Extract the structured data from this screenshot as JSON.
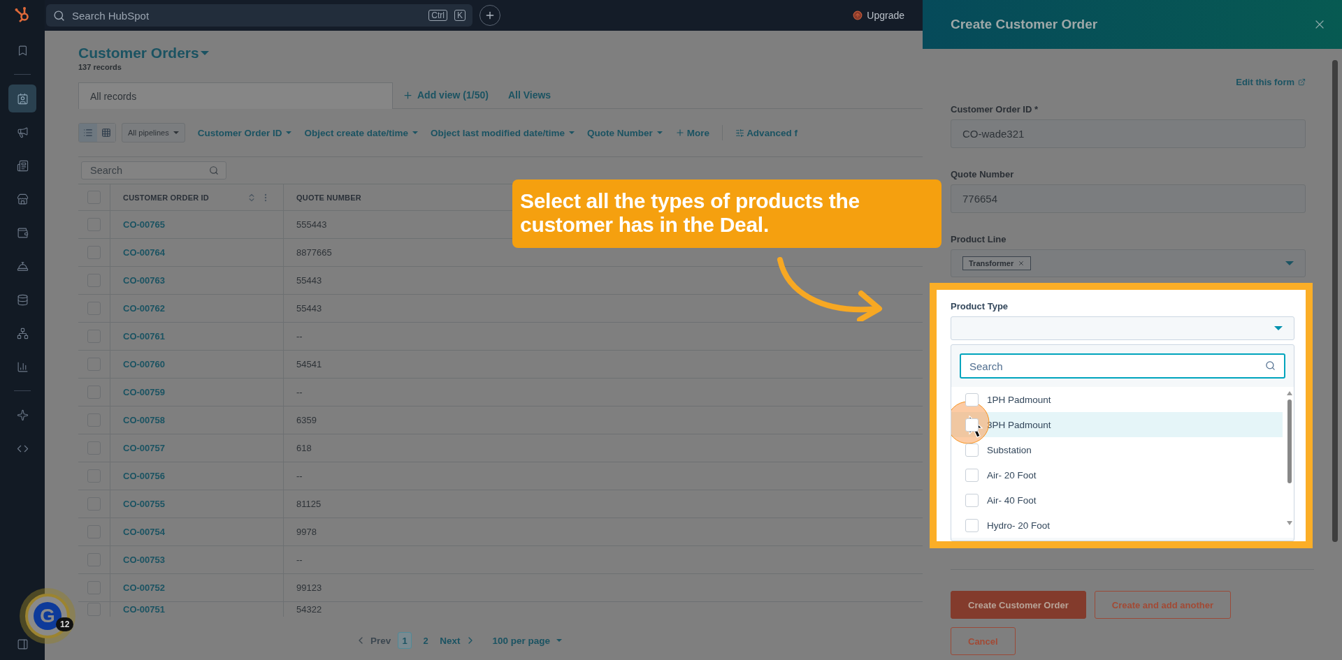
{
  "top_bar": {
    "search_placeholder": "Search HubSpot",
    "shortcut_keys": [
      "Ctrl",
      "K"
    ],
    "upgrade": "Upgrade"
  },
  "sidebar": {
    "items": [
      {
        "selected": false
      },
      {
        "selected": true
      },
      {
        "selected": false
      },
      {
        "selected": false
      },
      {
        "selected": false
      },
      {
        "selected": false
      },
      {
        "selected": false
      },
      {
        "selected": false
      },
      {
        "selected": false
      },
      {
        "selected": false
      },
      {
        "selected": false
      },
      {
        "selected": false
      }
    ]
  },
  "view": {
    "title": "Customer Orders",
    "record_count": "137 records"
  },
  "view_tabs": [
    {
      "label": "All records",
      "selected": true
    }
  ],
  "add_view": "Add view (1/50)",
  "all_views": "All Views",
  "filters": {
    "view_modes": [
      {
        "selected": true
      },
      {
        "selected": false
      }
    ],
    "pipeline": "All pipelines",
    "items": [
      "Customer Order ID",
      "Object create date/time",
      "Object last modified date/time",
      "Quote Number"
    ],
    "more": "More",
    "advanced": "Advanced f"
  },
  "table": {
    "search_placeholder": "Search",
    "all_checked": false,
    "columns": [
      "CUSTOMER ORDER ID",
      "QUOTE NUMBER"
    ],
    "rows": [
      {
        "id": "CO-00765",
        "quote": "555443",
        "checked": false
      },
      {
        "id": "CO-00764",
        "quote": "8877665",
        "checked": false
      },
      {
        "id": "CO-00763",
        "quote": "55443",
        "checked": false
      },
      {
        "id": "CO-00762",
        "quote": "55443",
        "checked": false
      },
      {
        "id": "CO-00761",
        "quote": "--",
        "checked": false
      },
      {
        "id": "CO-00760",
        "quote": "54541",
        "checked": false
      },
      {
        "id": "CO-00759",
        "quote": "--",
        "checked": false
      },
      {
        "id": "CO-00758",
        "quote": "6359",
        "checked": false
      },
      {
        "id": "CO-00757",
        "quote": "618",
        "checked": false
      },
      {
        "id": "CO-00756",
        "quote": "--",
        "checked": false
      },
      {
        "id": "CO-00755",
        "quote": "81125",
        "checked": false
      },
      {
        "id": "CO-00754",
        "quote": "9978",
        "checked": false
      },
      {
        "id": "CO-00753",
        "quote": "--",
        "checked": false
      },
      {
        "id": "CO-00752",
        "quote": "99123",
        "checked": false
      },
      {
        "id": "CO-00751",
        "quote": "54322",
        "checked": false
      }
    ]
  },
  "pagination": {
    "prev": "Prev",
    "pages": [
      {
        "label": "1",
        "selected": true
      },
      {
        "label": "2",
        "selected": false
      }
    ],
    "next": "Next",
    "per_page": "100 per page"
  },
  "callout": {
    "text": "Select all the types of products the customer has in the Deal."
  },
  "panel": {
    "title": "Create Customer Order",
    "edit_link": "Edit this form",
    "fields": [
      {
        "label": "Customer Order ID *",
        "value": "CO-wade321"
      },
      {
        "label": "Quote Number",
        "value": "776654"
      }
    ],
    "product_line": {
      "label": "Product Line",
      "tags": [
        "Transformer"
      ]
    },
    "product_type": {
      "label": "Product Type",
      "expanded": true,
      "search_placeholder": "Search",
      "options": [
        {
          "label": "1PH Padmount",
          "checked": false,
          "highlighted": false
        },
        {
          "label": "3PH Padmount",
          "checked": false,
          "highlighted": true
        },
        {
          "label": "Substation",
          "checked": false,
          "highlighted": false
        },
        {
          "label": "Air- 20 Foot",
          "checked": false,
          "highlighted": false
        },
        {
          "label": "Air- 40 Foot",
          "checked": false,
          "highlighted": false
        },
        {
          "label": "Hydro- 20 Foot",
          "checked": false,
          "highlighted": false
        }
      ]
    },
    "buttons": [
      {
        "label": "Create Customer Order",
        "kind": "primary"
      },
      {
        "label": "Create and add another",
        "kind": "secondary"
      },
      {
        "label": "Cancel",
        "kind": "secondary"
      }
    ]
  },
  "widget": {
    "letter": "G",
    "count": "12"
  }
}
